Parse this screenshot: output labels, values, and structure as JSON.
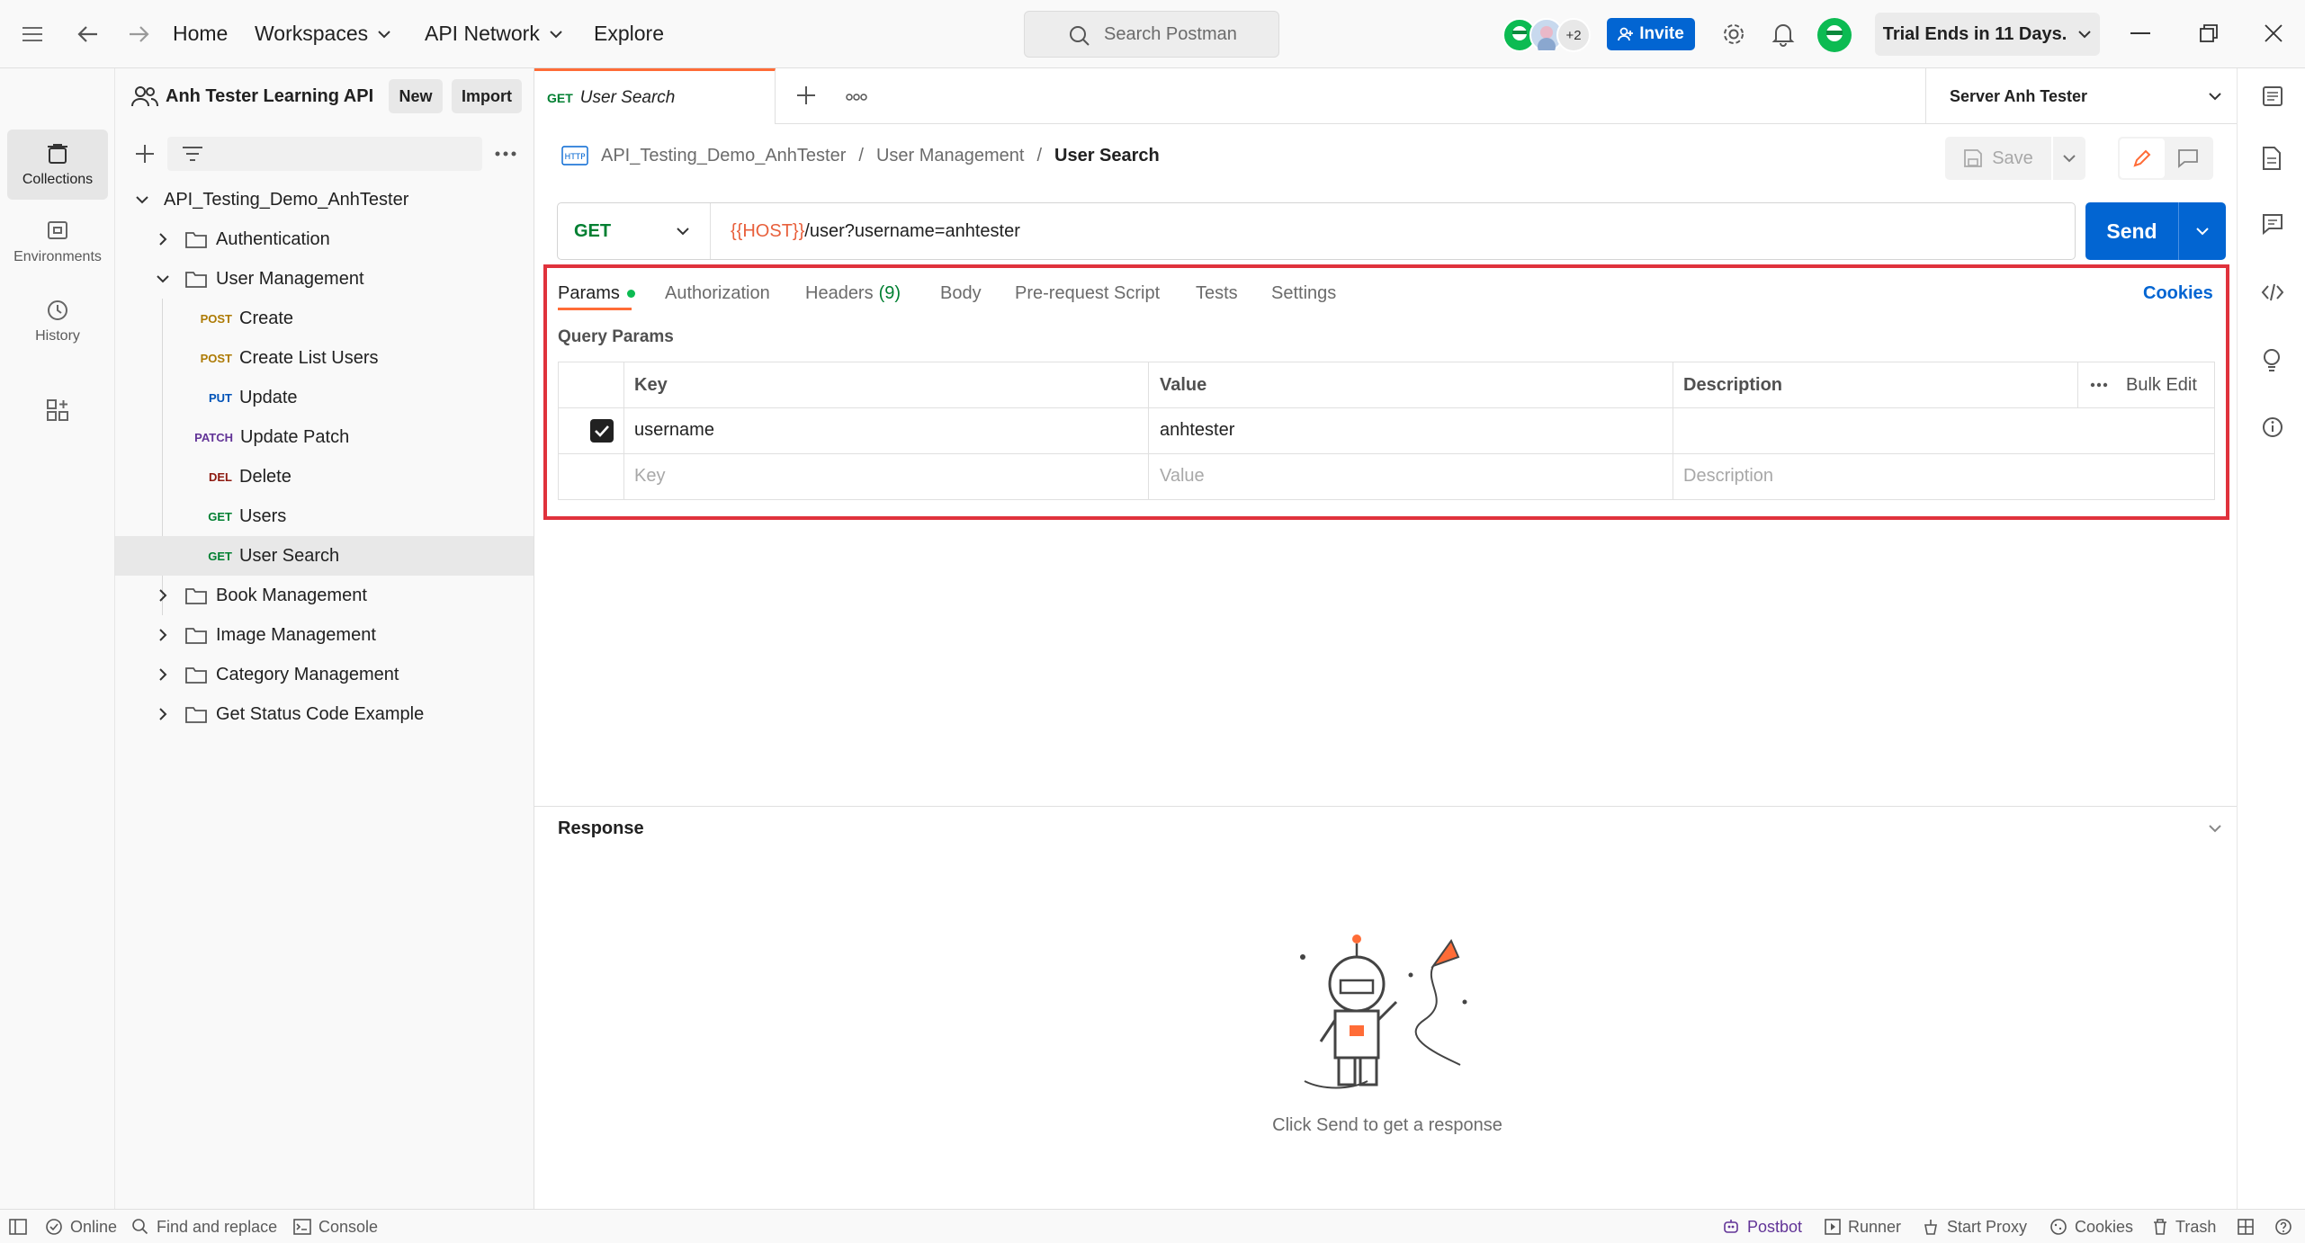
{
  "topbar": {
    "nav": [
      "Home",
      "Workspaces",
      "API Network",
      "Explore"
    ],
    "search_placeholder": "Search Postman",
    "avatar_count": "+2",
    "invite_label": "Invite",
    "trial_label": "Trial Ends in 11 Days."
  },
  "rail": {
    "items": [
      "Collections",
      "Environments",
      "History"
    ]
  },
  "sidebar": {
    "workspace_title": "Anh Tester Learning API",
    "new_label": "New",
    "import_label": "Import",
    "collection": "API_Testing_Demo_AnhTester",
    "folders_top": [
      "Authentication",
      "User Management"
    ],
    "requests": [
      {
        "method": "POST",
        "name": "Create"
      },
      {
        "method": "POST",
        "name": "Create List Users"
      },
      {
        "method": "PUT",
        "name": "Update"
      },
      {
        "method": "PATCH",
        "name": "Update Patch"
      },
      {
        "method": "DEL",
        "name": "Delete"
      },
      {
        "method": "GET",
        "name": "Users"
      },
      {
        "method": "GET",
        "name": "User Search"
      }
    ],
    "folders_bottom": [
      "Book Management",
      "Image Management",
      "Category Management",
      "Get Status Code Example"
    ]
  },
  "tab": {
    "method": "GET",
    "name": "User Search",
    "environment": "Server Anh Tester"
  },
  "breadcrumb": {
    "collection": "API_Testing_Demo_AnhTester",
    "folder": "User Management",
    "request": "User Search",
    "sep": "/"
  },
  "request": {
    "save_label": "Save",
    "method": "GET",
    "url_var": "{{HOST}}",
    "url_rest": "/user?username=anhtester",
    "send_label": "Send",
    "tabs": {
      "params": "Params",
      "authorization": "Authorization",
      "headers": "Headers",
      "headers_count": "(9)",
      "body": "Body",
      "prerequest": "Pre-request Script",
      "tests": "Tests",
      "settings": "Settings"
    },
    "cookies_label": "Cookies",
    "query_params_title": "Query Params",
    "columns": {
      "key": "Key",
      "value": "Value",
      "description": "Description",
      "bulk_edit": "Bulk Edit"
    },
    "row": {
      "key": "username",
      "value": "anhtester"
    },
    "placeholders": {
      "key": "Key",
      "value": "Value",
      "description": "Description"
    }
  },
  "response": {
    "title": "Response",
    "empty_text": "Click Send to get a response"
  },
  "statusbar": {
    "online": "Online",
    "find_replace": "Find and replace",
    "console": "Console",
    "postbot": "Postbot",
    "runner": "Runner",
    "start_proxy": "Start Proxy",
    "cookies": "Cookies",
    "trash": "Trash"
  },
  "colors": {
    "accent": "#0265d2",
    "orange": "#ff6c37",
    "highlight": "#e0323c",
    "params_dot": "#0cbb52"
  }
}
